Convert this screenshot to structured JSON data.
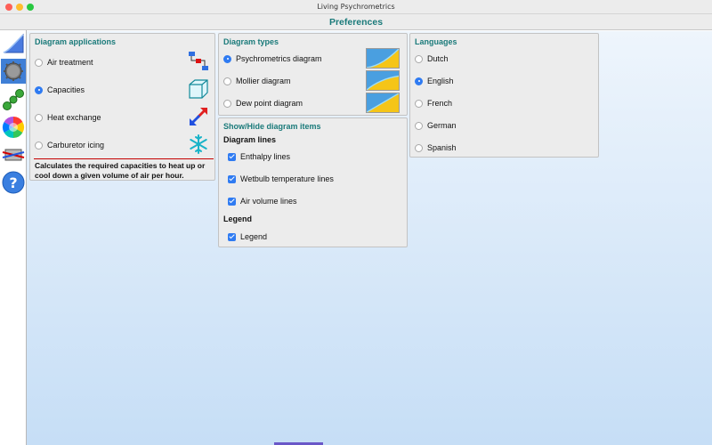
{
  "window": {
    "title": "Living Psychrometrics"
  },
  "preferences": {
    "title": "Preferences"
  },
  "sidebar": {
    "items": [
      {
        "icon": "psychrometric-chart-icon"
      },
      {
        "icon": "gear-icon"
      },
      {
        "icon": "process-nodes-icon"
      },
      {
        "icon": "color-wheel-icon"
      },
      {
        "icon": "heat-exchanger-icon"
      },
      {
        "icon": "help-icon"
      }
    ]
  },
  "diagram_applications": {
    "title": "Diagram applications",
    "options": [
      {
        "label": "Air treatment",
        "selected": false,
        "icon": "air-treatment-icon"
      },
      {
        "label": "Capacities",
        "selected": true,
        "icon": "cube-icon"
      },
      {
        "label": "Heat exchange",
        "selected": false,
        "icon": "heat-exchange-arrows-icon"
      },
      {
        "label": "Carburetor icing",
        "selected": false,
        "icon": "snowflake-icon"
      }
    ],
    "description": "Calculates the required capacities to heat up or cool down a given volume of air per hour."
  },
  "diagram_types": {
    "title": "Diagram types",
    "options": [
      {
        "label": "Psychrometrics diagram",
        "selected": true
      },
      {
        "label": "Mollier diagram",
        "selected": false
      },
      {
        "label": "Dew point diagram",
        "selected": false
      }
    ]
  },
  "show_hide": {
    "title": "Show/Hide diagram items",
    "diagram_lines_heading": "Diagram lines",
    "lines": [
      {
        "label": "Enthalpy lines",
        "checked": true
      },
      {
        "label": "Wetbulb temperature lines",
        "checked": true
      },
      {
        "label": "Air volume lines",
        "checked": true
      }
    ],
    "legend_heading": "Legend",
    "legend": {
      "label": "Legend",
      "checked": true
    }
  },
  "languages": {
    "title": "Languages",
    "options": [
      {
        "label": "Dutch",
        "selected": false
      },
      {
        "label": "English",
        "selected": true
      },
      {
        "label": "French",
        "selected": false
      },
      {
        "label": "German",
        "selected": false
      },
      {
        "label": "Spanish",
        "selected": false
      }
    ]
  },
  "colors": {
    "accent": "#1a7a7a",
    "selection": "#2f7bf2",
    "thumb_blue": "#4a9fe0",
    "thumb_yellow": "#f5c518"
  }
}
